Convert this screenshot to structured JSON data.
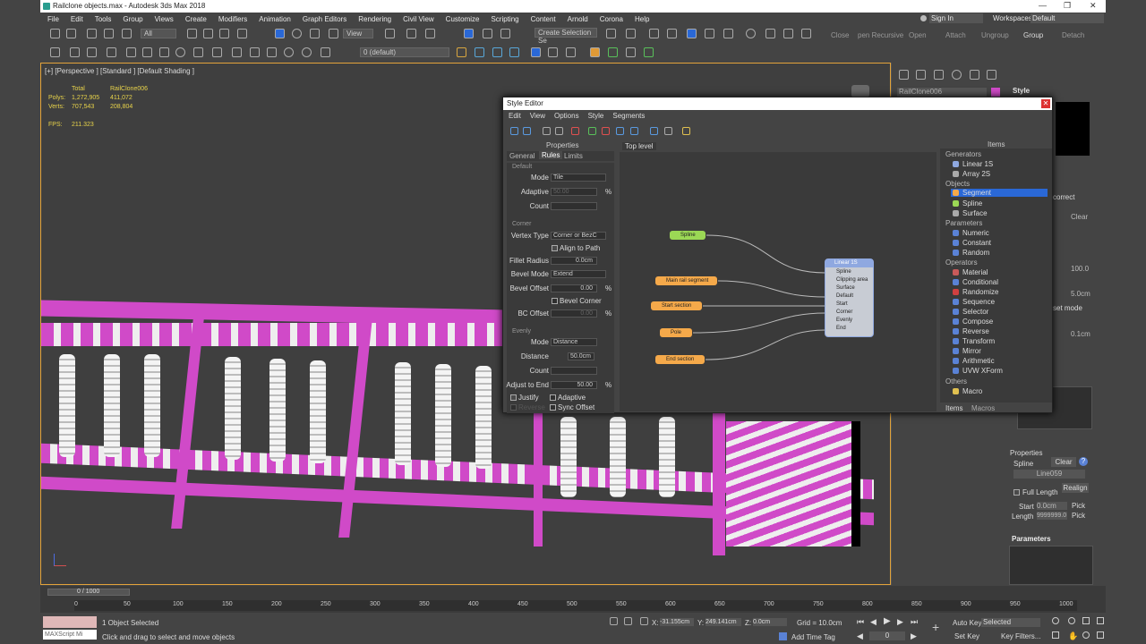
{
  "title": "Railclone objects.max - Autodesk 3ds Max 2018",
  "menu": [
    "File",
    "Edit",
    "Tools",
    "Group",
    "Views",
    "Create",
    "Modifiers",
    "Animation",
    "Graph Editors",
    "Rendering",
    "Civil View",
    "Customize",
    "Scripting",
    "Content",
    "Arnold",
    "Corona",
    "Help"
  ],
  "account": {
    "sign_in": "Sign In",
    "workspaces_label": "Workspaces:",
    "workspaces_value": "Default"
  },
  "toolbar": {
    "filter": "All",
    "view": "View",
    "selection_set": "Create Selection Se",
    "layer": "0 (default)",
    "right_labels": [
      "Close",
      "pen Recursive",
      "Open",
      "Attach",
      "Ungroup",
      "Group",
      "Detach"
    ]
  },
  "viewport": {
    "label": "[+] [Perspective ] [Standard ] [Default Shading ]",
    "stats": {
      "total_label": "Total",
      "object_label": "RailClone006",
      "polys_label": "Polys:",
      "polys_total": "1,272,905",
      "polys_obj": "411,072",
      "verts_label": "Verts:",
      "verts_total": "707,543",
      "verts_obj": "208,804",
      "fps_label": "FPS:",
      "fps": "211.323"
    }
  },
  "style_editor": {
    "title": "Style Editor",
    "menu": [
      "Edit",
      "View",
      "Options",
      "Style",
      "Segments"
    ],
    "properties": {
      "header": "Properties",
      "tabs": [
        "General",
        "Rules",
        "Limits"
      ],
      "default_group": "Default",
      "mode_label": "Mode",
      "mode_value": "Tile",
      "adaptive_label": "Adaptive",
      "adaptive_value": "50.00",
      "count_label": "Count",
      "corner_group": "Corner",
      "vertex_type_label": "Vertex Type",
      "vertex_type_value": "Corner or BezC",
      "align_label": "Align to Path",
      "fillet_label": "Fillet Radius",
      "fillet_value": "0.0cm",
      "bevel_mode_label": "Bevel Mode",
      "bevel_mode_value": "Extend",
      "bevel_offset_label": "Bevel Offset",
      "bevel_offset_value": "0.00",
      "bevel_corner_label": "Bevel Corner",
      "bc_offset_label": "BC Offset",
      "bc_offset_value": "0.00",
      "evenly_group": "Evenly",
      "evenly_mode_label": "Mode",
      "evenly_mode_value": "Distance",
      "distance_label": "Distance",
      "distance_value": "50.0cm",
      "evenly_count_label": "Count",
      "adjust_label": "Adjust to End",
      "adjust_value": "50.00",
      "justify_label": "Justify",
      "adaptive2_label": "Adaptive",
      "reverse_label": "Reverse",
      "sync_label": "Sync Offset",
      "pct": "%"
    },
    "graph": {
      "tab": "Top level",
      "nodes": {
        "spline": "Spline",
        "main_rail": "Main rail segment",
        "start_section": "Start section",
        "pole": "Pole",
        "end_section": "End section",
        "generator": "Linear 1S"
      },
      "ports": [
        "Spline",
        "Clipping area",
        "Surface",
        "Default",
        "Start",
        "Corner",
        "Evenly",
        "End"
      ]
    },
    "items": {
      "header": "Items",
      "generators_label": "Generators",
      "generators": [
        "Linear 1S",
        "Array 2S"
      ],
      "objects_label": "Objects",
      "objects": [
        "Segment",
        "Spline",
        "Surface"
      ],
      "parameters_label": "Parameters",
      "parameters": [
        "Numeric",
        "Constant",
        "Random"
      ],
      "operators_label": "Operators",
      "operators": [
        "Material",
        "Conditional",
        "Randomize",
        "Sequence",
        "Selector",
        "Compose",
        "Reverse",
        "Transform",
        "Mirror",
        "Arithmetic",
        "UVW XForm"
      ],
      "others_label": "Others",
      "others": [
        "Macro"
      ],
      "bottom_tabs": [
        "Items",
        "Macros"
      ]
    }
  },
  "command_panel": {
    "object_name": "RailClone006",
    "rollout": "Style",
    "properties_label": "Properties",
    "spline_label": "Spline",
    "clear_label": "Clear",
    "spline_value": "Line059",
    "full_length_label": "Full Length",
    "realign_label": "Realign",
    "start_label": "Start",
    "start_value": "0.0cm",
    "pick_label": "Pick",
    "length_label": "Length",
    "length_value": "9999999.0",
    "parameters_label": "Parameters",
    "correct_label": "correct",
    "clear2": "Clear",
    "pct_value": "100.0",
    "cm_value": "5.0cm",
    "set_mode": "set mode",
    "cm2_value": "0.1cm"
  },
  "timeline": {
    "frame": "0 / 1000",
    "ticks": [
      "0",
      "50",
      "100",
      "150",
      "200",
      "250",
      "300",
      "350",
      "400",
      "450",
      "500",
      "550",
      "600",
      "650",
      "700",
      "750",
      "800",
      "850",
      "900",
      "950",
      "1000"
    ]
  },
  "status": {
    "selected": "1 Object Selected",
    "prompt": "Click and drag to select and move objects",
    "maxscript": "MAXScript Mi",
    "x_label": "X:",
    "x": "-31.155cm",
    "y_label": "Y:",
    "y": "249.141cm",
    "z_label": "Z:",
    "z": "0.0cm",
    "grid": "Grid = 10.0cm",
    "add_time_tag": "Add Time Tag",
    "auto_key": "Auto Key",
    "selected_dd": "Selected",
    "set_key": "Set Key",
    "key_filters": "Key Filters...",
    "frame_value": "0"
  },
  "colors": {
    "accent_pink": "#d04ac8",
    "viewport_border": "#e3a33a",
    "highlight": "#2a68d6",
    "node_green": "#9bd855",
    "node_orange": "#f5a94a",
    "node_blue": "#8fa8e0"
  }
}
